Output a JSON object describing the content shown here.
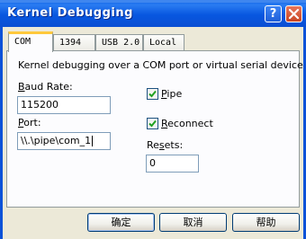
{
  "window": {
    "title": "Kernel Debugging",
    "help_icon": "?",
    "close_icon": "x"
  },
  "tabs": [
    {
      "label": "COM",
      "active": true
    },
    {
      "label": "1394",
      "active": false
    },
    {
      "label": "USB 2.0",
      "active": false
    },
    {
      "label": "Local",
      "active": false
    }
  ],
  "com_tab": {
    "description": "Kernel debugging over a COM port or virtual serial device",
    "baud_rate": {
      "label_accel": "B",
      "label_rest": "aud Rate:",
      "value": "115200"
    },
    "port": {
      "label_accel": "P",
      "label_rest": "ort:",
      "value": "\\\\.\\pipe\\com_1"
    },
    "pipe": {
      "label_accel": "P",
      "label_rest": "ipe",
      "checked": true
    },
    "reconnect": {
      "label_accel": "R",
      "label_rest": "econnect",
      "checked": true
    },
    "resets": {
      "label_pre": "Re",
      "label_accel": "s",
      "label_rest": "ets:",
      "value": "0"
    }
  },
  "buttons": {
    "ok": "确定",
    "cancel": "取消",
    "help": "帮助"
  },
  "colors": {
    "titlebar": "#0a58e0",
    "dialog_bg": "#ece9d8",
    "tab_highlight": "#ffc83c",
    "check": "#21a121"
  }
}
